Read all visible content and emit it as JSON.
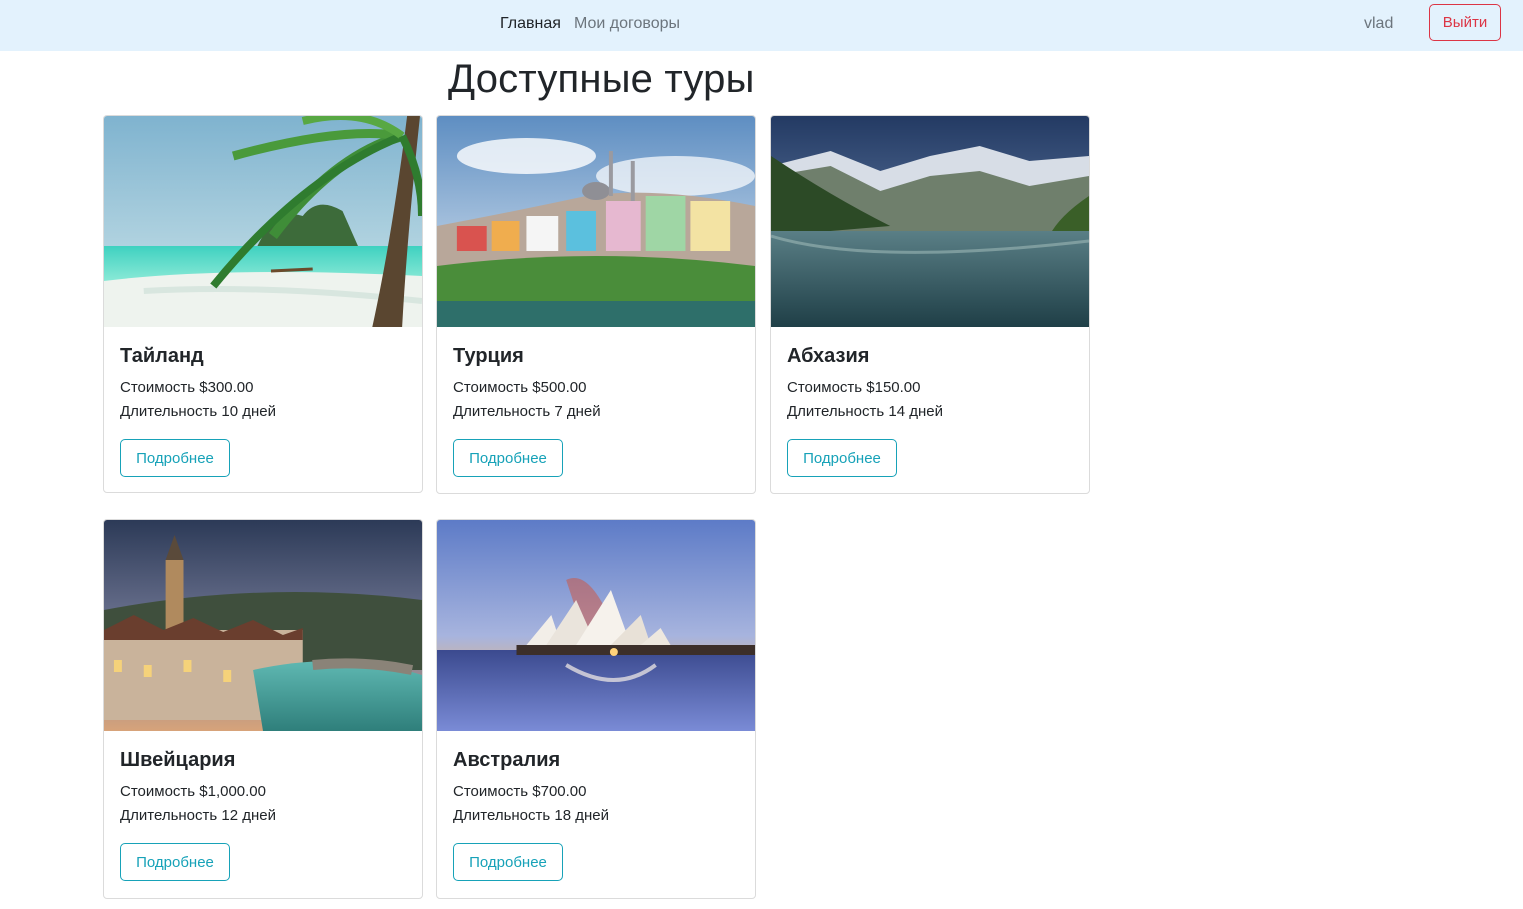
{
  "navbar": {
    "home_label": "Главная",
    "contracts_label": "Мои договоры",
    "username": "vlad",
    "logout_label": "Выйти"
  },
  "page": {
    "title": "Доступные туры"
  },
  "tours": [
    {
      "name": "Тайланд",
      "price": "Стоимость $300.00",
      "duration": "Длительность 10 дней",
      "button": "Подробнее"
    },
    {
      "name": "Турция",
      "price": "Стоимость $500.00",
      "duration": "Длительность 7 дней",
      "button": "Подробнее"
    },
    {
      "name": "Абхазия",
      "price": "Стоимость $150.00",
      "duration": "Длительность 14 дней",
      "button": "Подробнее"
    },
    {
      "name": "Швейцария",
      "price": "Стоимость $1,000.00",
      "duration": "Длительность 12 дней",
      "button": "Подробнее"
    },
    {
      "name": "Австралия",
      "price": "Стоимость $700.00",
      "duration": "Длительность 18 дней",
      "button": "Подробнее"
    }
  ],
  "colors": {
    "navbar_bg": "#e3f2fd",
    "logout_accent": "#dc3545",
    "details_accent": "#17a2b8"
  }
}
